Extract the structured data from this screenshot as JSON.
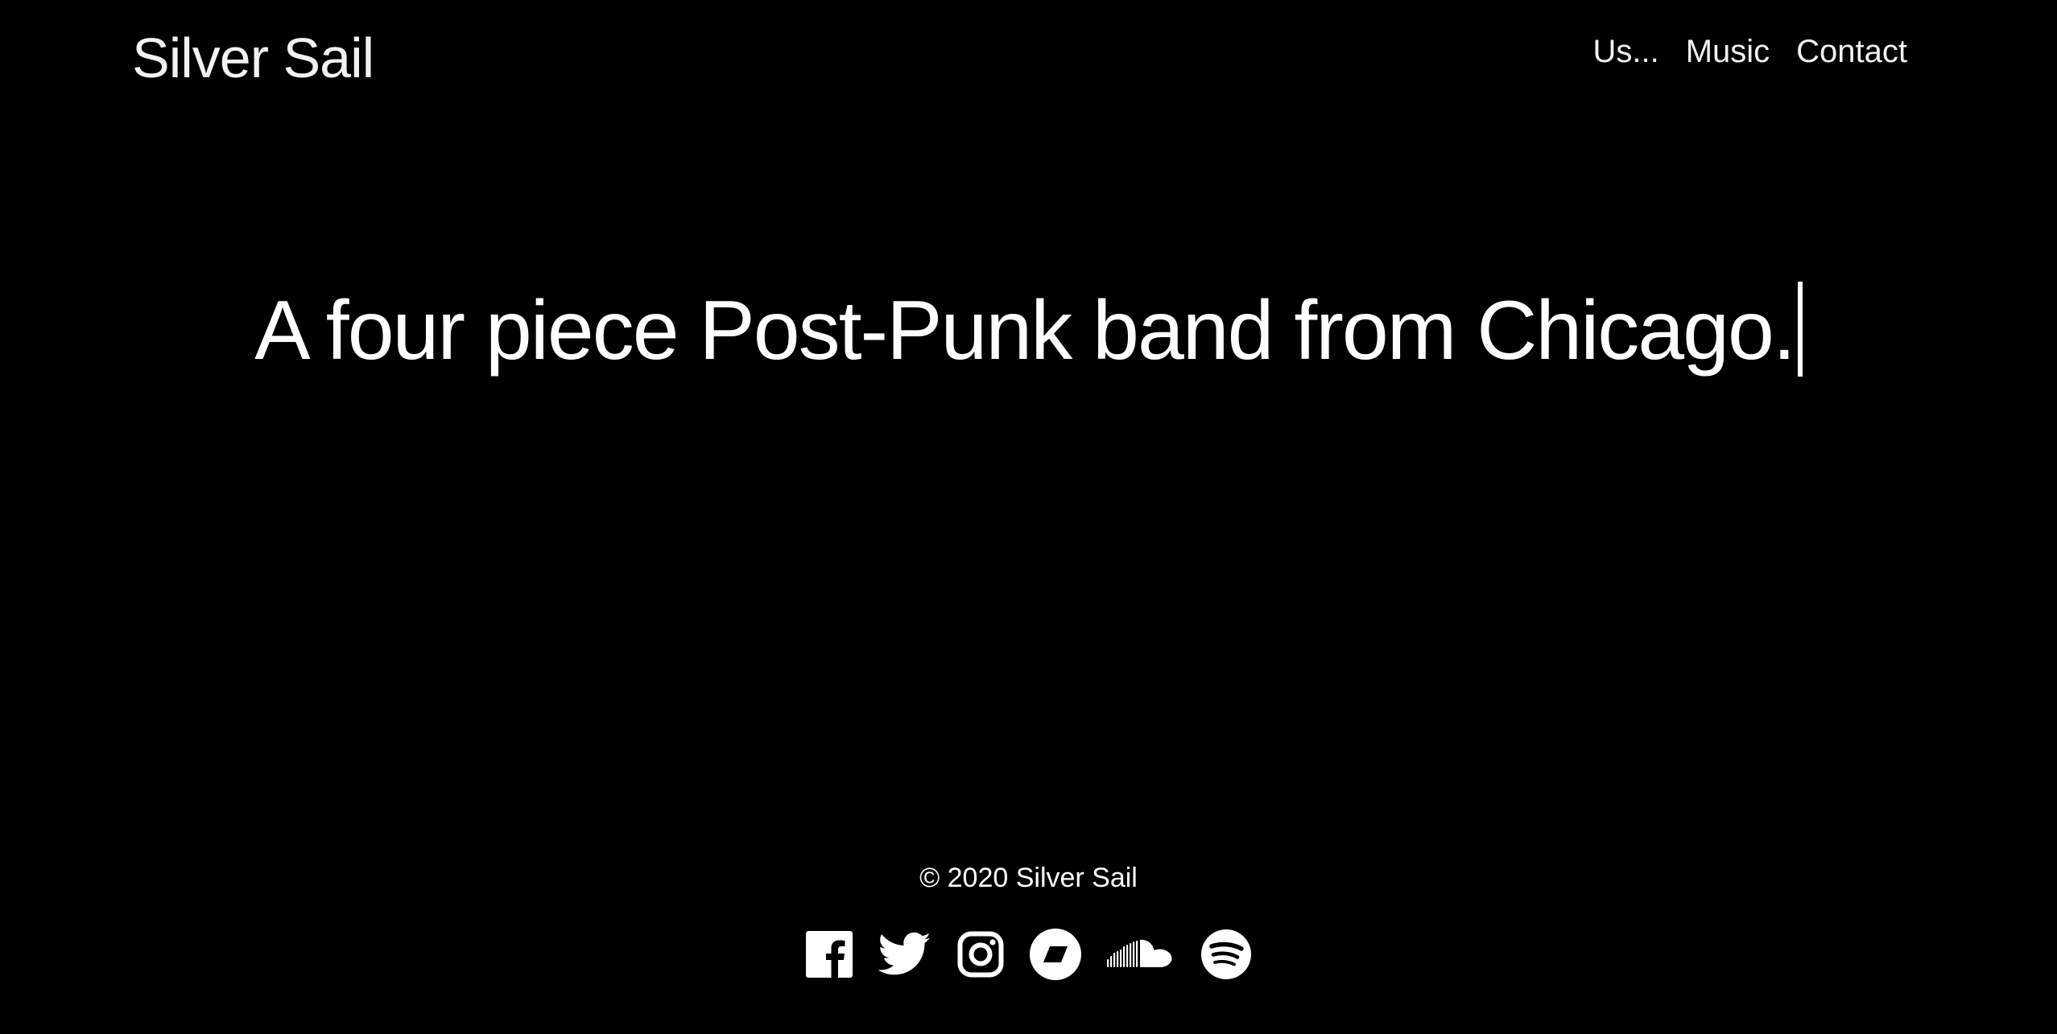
{
  "header": {
    "brand": "Silver Sail",
    "nav": [
      {
        "label": "Us..."
      },
      {
        "label": "Music"
      },
      {
        "label": "Contact"
      }
    ]
  },
  "hero": {
    "text": "A four piece Post-Punk band from Chicago."
  },
  "footer": {
    "copyright": "© 2020 Silver Sail",
    "social_icons": [
      "facebook-icon",
      "twitter-icon",
      "instagram-icon",
      "bandcamp-icon",
      "soundcloud-icon",
      "spotify-icon"
    ]
  },
  "colors": {
    "background": "#000000",
    "text": "#ffffff"
  }
}
